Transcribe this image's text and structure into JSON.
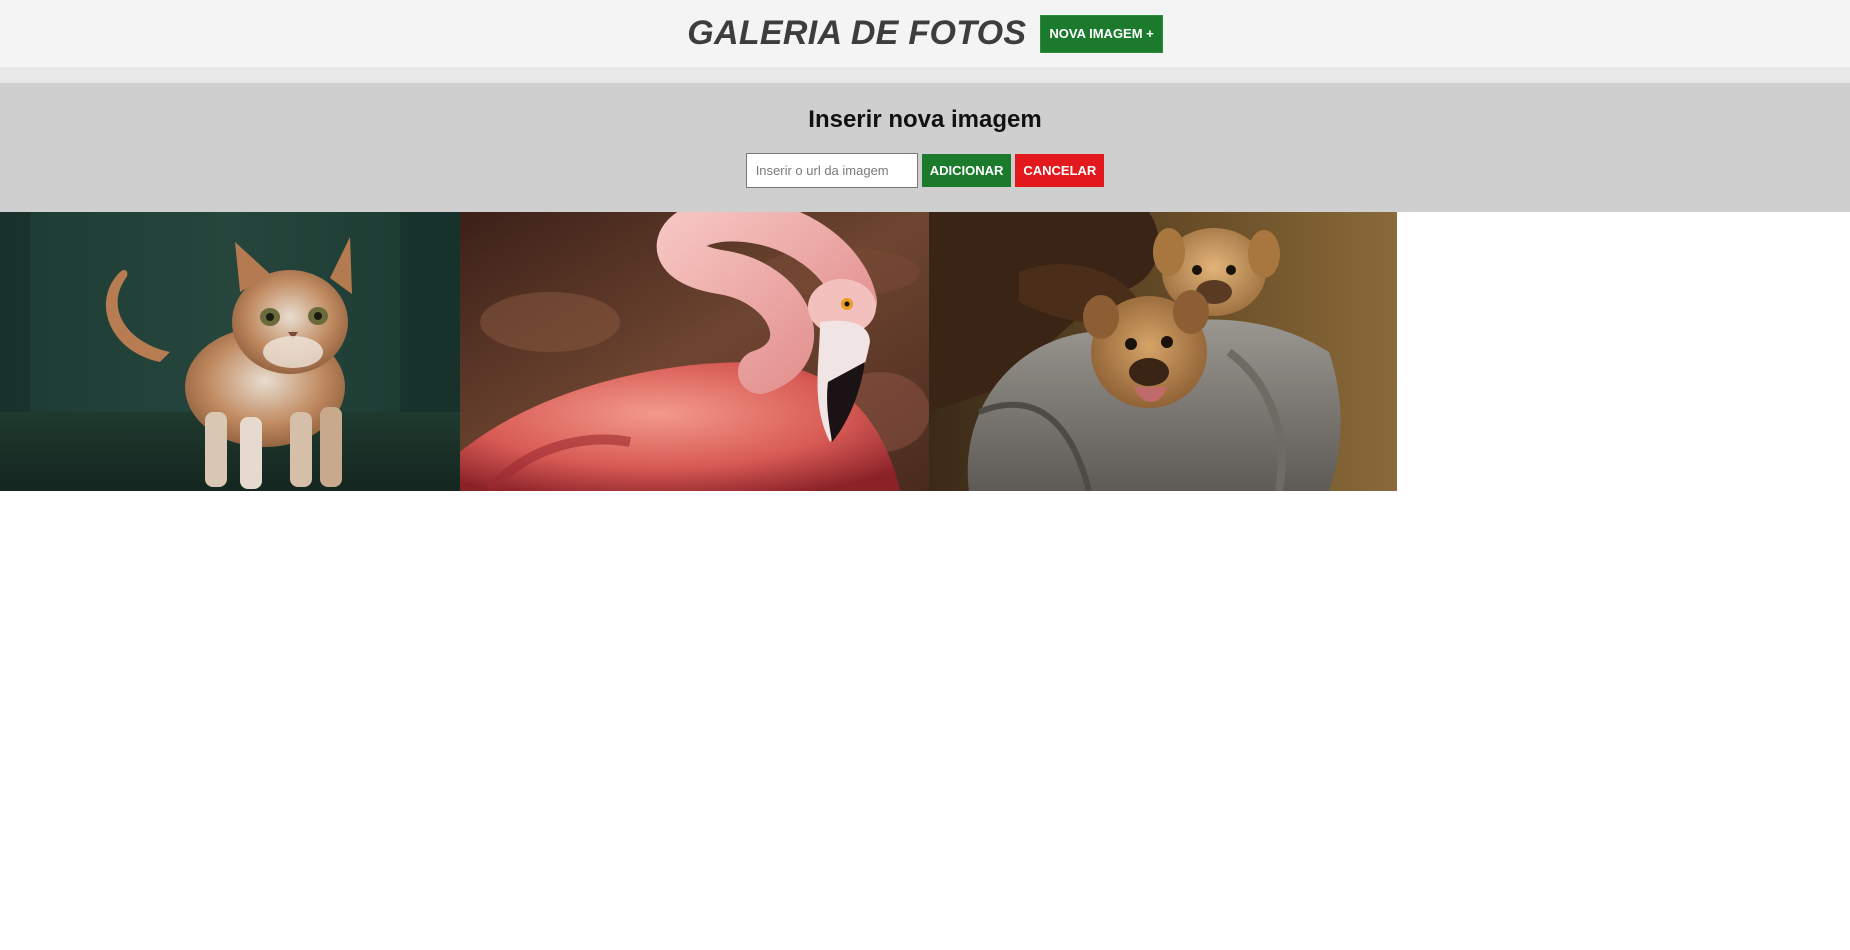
{
  "header": {
    "title": "GALERIA DE FOTOS",
    "new_image_button": "NOVA IMAGEM +"
  },
  "insert_panel": {
    "title": "Inserir nova imagem",
    "url_input": {
      "value": "",
      "placeholder": "Inserir o url da imagem"
    },
    "add_button": "ADICIONAR",
    "cancel_button": "CANCELAR"
  },
  "gallery": {
    "photos": [
      {
        "subject": "cat"
      },
      {
        "subject": "flamingo"
      },
      {
        "subject": "puppies"
      }
    ]
  },
  "colors": {
    "header_bg": "#f4f4f4",
    "panel_bg": "#cfcfcf",
    "green": "#1c7a2d",
    "red": "#e3191e"
  }
}
